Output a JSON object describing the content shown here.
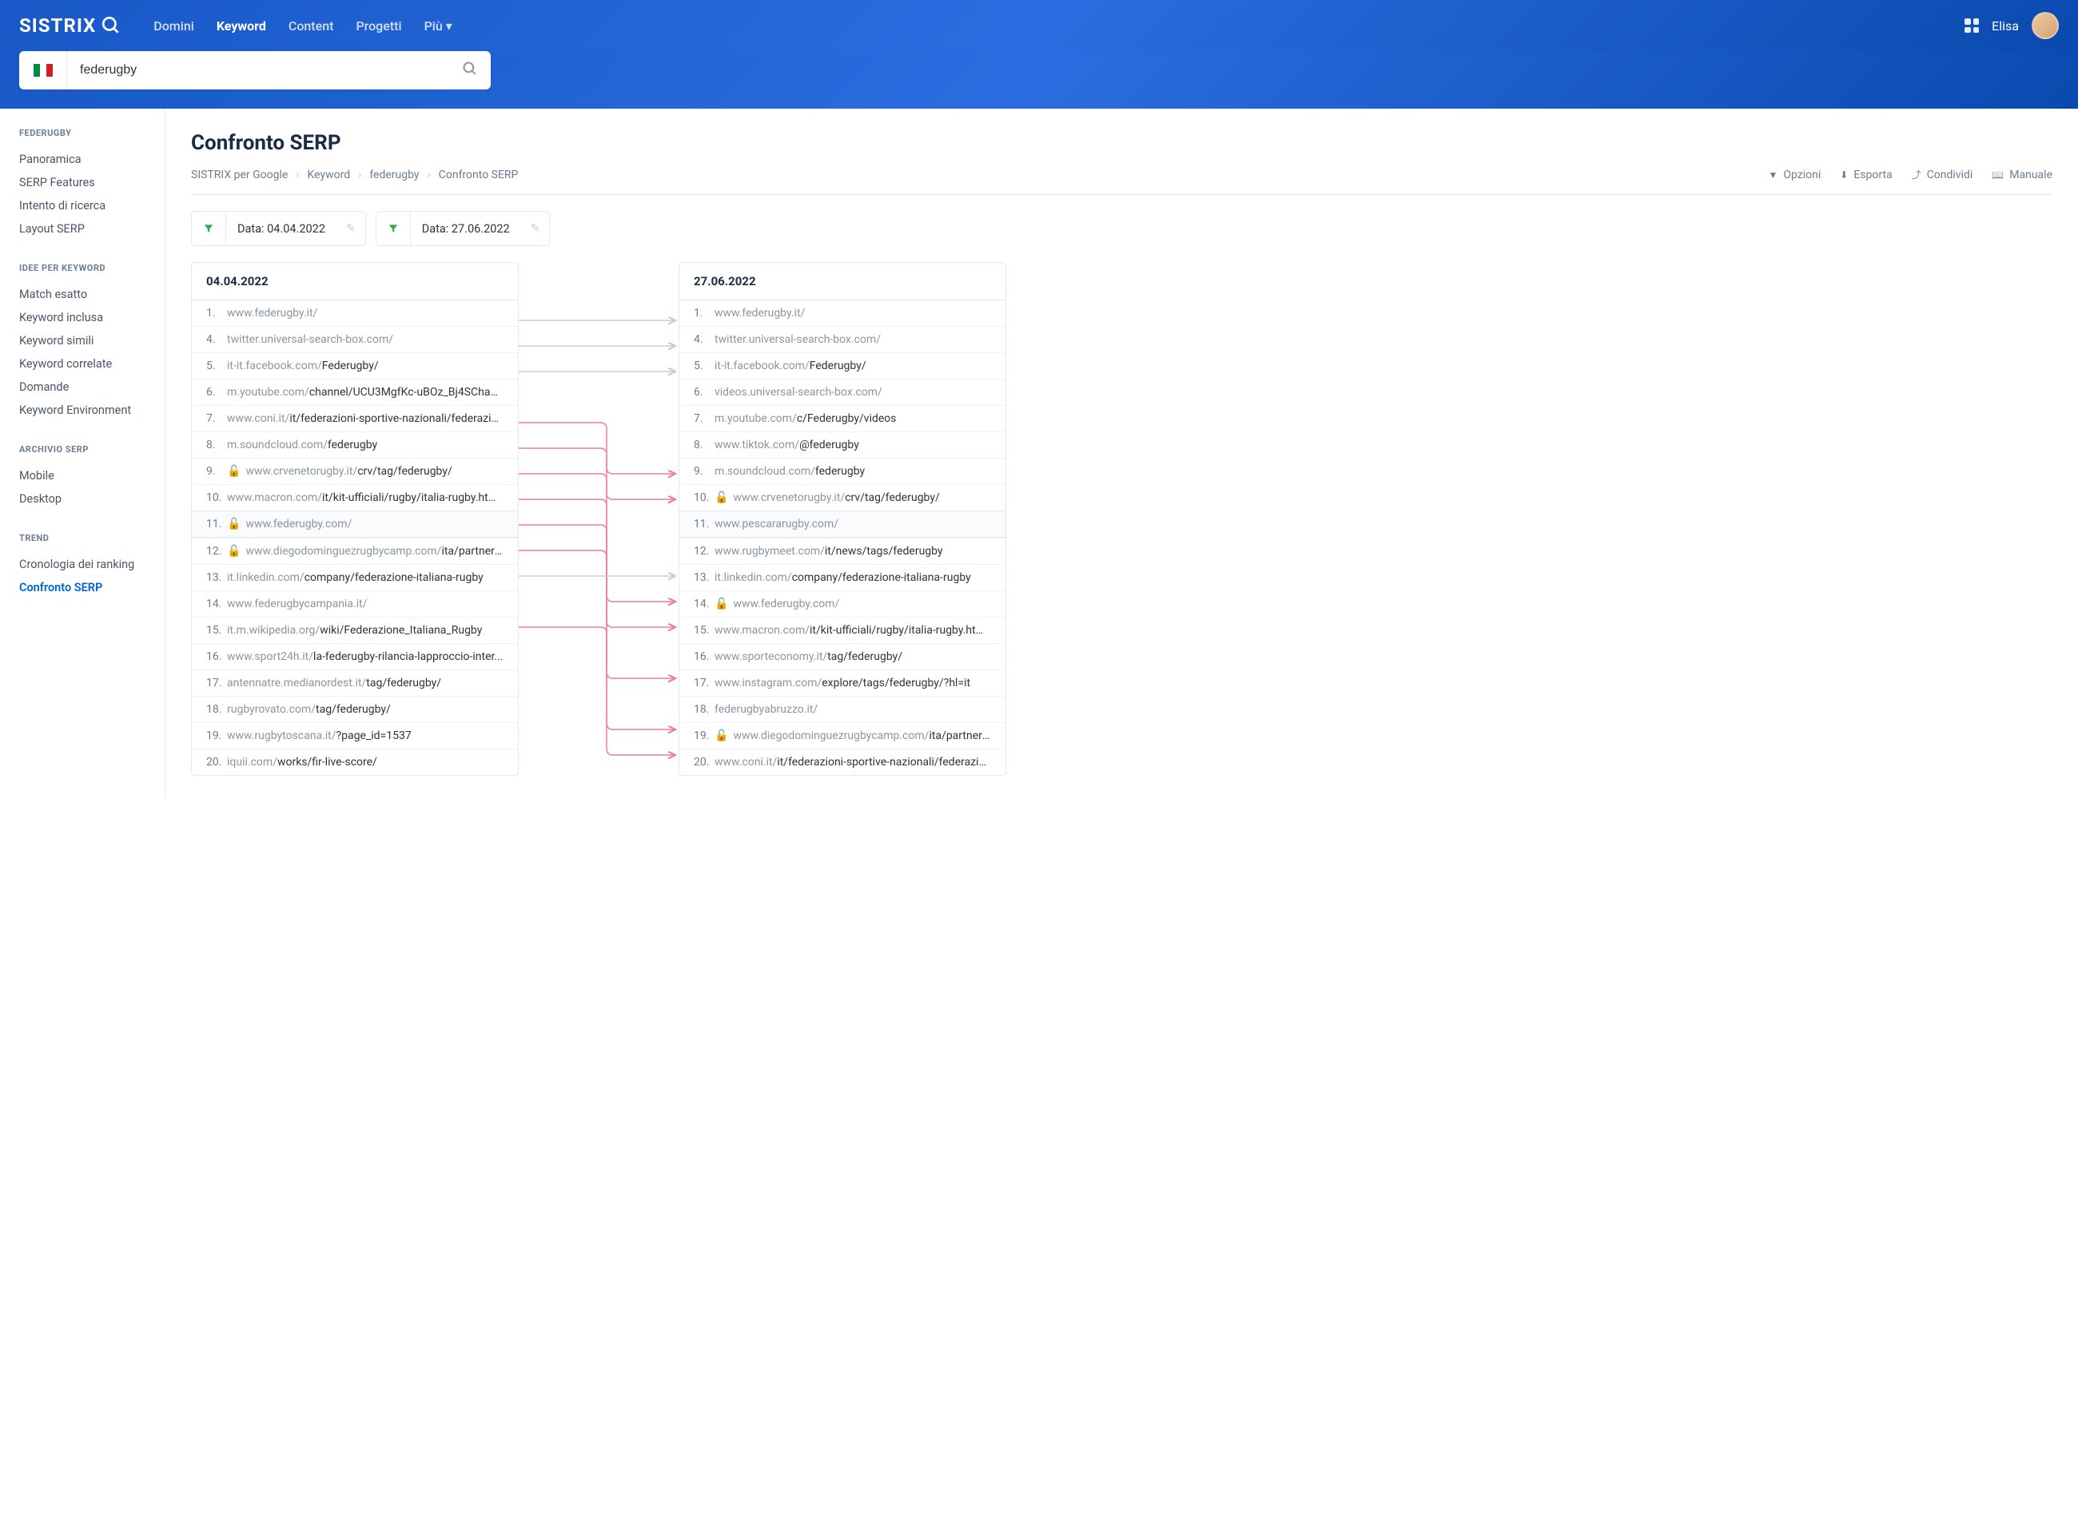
{
  "header": {
    "logo": "SISTRIX",
    "nav": [
      "Domini",
      "Keyword",
      "Content",
      "Progetti",
      "Più"
    ],
    "nav_active": 1,
    "user": "Elisa"
  },
  "search": {
    "value": "federugby"
  },
  "sidebar": {
    "sections": [
      {
        "title": "FEDERUGBY",
        "items": [
          "Panoramica",
          "SERP Features",
          "Intento di ricerca",
          "Layout SERP"
        ]
      },
      {
        "title": "IDEE PER KEYWORD",
        "items": [
          "Match esatto",
          "Keyword inclusa",
          "Keyword simili",
          "Keyword correlate",
          "Domande",
          "Keyword Environment"
        ]
      },
      {
        "title": "ARCHIVIO SERP",
        "items": [
          "Mobile",
          "Desktop"
        ]
      },
      {
        "title": "TREND",
        "items": [
          "Cronologia dei ranking",
          "Confronto SERP"
        ],
        "active": 1
      }
    ]
  },
  "page": {
    "title": "Confronto SERP",
    "breadcrumb": [
      "SISTRIX per Google",
      "Keyword",
      "federugby",
      "Confronto SERP"
    ],
    "actions": [
      "Opzioni",
      "Esporta",
      "Condividi",
      "Manuale"
    ],
    "filters": [
      "Data: 04.04.2022",
      "Data: 27.06.2022"
    ]
  },
  "serp": {
    "left": {
      "date": "04.04.2022",
      "rows": [
        {
          "rank": "1.",
          "domain": "www.federugby.it/",
          "path": ""
        },
        {
          "rank": "4.",
          "domain": "twitter.universal-search-box.com/",
          "path": ""
        },
        {
          "rank": "5.",
          "domain": "it-it.facebook.com/",
          "path": "Federugby/"
        },
        {
          "rank": "6.",
          "domain": "m.youtube.com/",
          "path": "channel/UCU3MgfKc-uBOz_Bj4SCha0..."
        },
        {
          "rank": "7.",
          "domain": "www.coni.it/",
          "path": "it/federazioni-sportive-nazionali/federazio..."
        },
        {
          "rank": "8.",
          "domain": "m.soundcloud.com/",
          "path": "federugby"
        },
        {
          "rank": "9.",
          "domain": "www.crvenetorugby.it/",
          "path": "crv/tag/federugby/",
          "lock": true
        },
        {
          "rank": "10.",
          "domain": "www.macron.com/",
          "path": "it/kit-ufficiali/rugby/italia-rugby.html..."
        },
        {
          "rank": "11.",
          "domain": "www.federugby.com/",
          "path": "",
          "lock": true,
          "band": true
        },
        {
          "rank": "12.",
          "domain": "www.diegodominguezrugbycamp.com/",
          "path": "ita/partner-s...",
          "lock": true
        },
        {
          "rank": "13.",
          "domain": "it.linkedin.com/",
          "path": "company/federazione-italiana-rugby"
        },
        {
          "rank": "14.",
          "domain": "www.federugbycampania.it/",
          "path": ""
        },
        {
          "rank": "15.",
          "domain": "it.m.wikipedia.org/",
          "path": "wiki/Federazione_Italiana_Rugby"
        },
        {
          "rank": "16.",
          "domain": "www.sport24h.it/",
          "path": "la-federugby-rilancia-lapproccio-inter..."
        },
        {
          "rank": "17.",
          "domain": "antennatre.medianordest.it/",
          "path": "tag/federugby/"
        },
        {
          "rank": "18.",
          "domain": "rugbyrovato.com/",
          "path": "tag/federugby/"
        },
        {
          "rank": "19.",
          "domain": "www.rugbytoscana.it/",
          "path": "?page_id=1537"
        },
        {
          "rank": "20.",
          "domain": "iquii.com/",
          "path": "works/fir-live-score/"
        }
      ]
    },
    "right": {
      "date": "27.06.2022",
      "rows": [
        {
          "rank": "1.",
          "domain": "www.federugby.it/",
          "path": ""
        },
        {
          "rank": "4.",
          "domain": "twitter.universal-search-box.com/",
          "path": ""
        },
        {
          "rank": "5.",
          "domain": "it-it.facebook.com/",
          "path": "Federugby/"
        },
        {
          "rank": "6.",
          "domain": "videos.universal-search-box.com/",
          "path": ""
        },
        {
          "rank": "7.",
          "domain": "m.youtube.com/",
          "path": "c/Federugby/videos"
        },
        {
          "rank": "8.",
          "domain": "www.tiktok.com/",
          "path": "@federugby"
        },
        {
          "rank": "9.",
          "domain": "m.soundcloud.com/",
          "path": "federugby"
        },
        {
          "rank": "10.",
          "domain": "www.crvenetorugby.it/",
          "path": "crv/tag/federugby/",
          "lock": true
        },
        {
          "rank": "11.",
          "domain": "www.pescararugby.com/",
          "path": "",
          "band": true
        },
        {
          "rank": "12.",
          "domain": "www.rugbymeet.com/",
          "path": "it/news/tags/federugby"
        },
        {
          "rank": "13.",
          "domain": "it.linkedin.com/",
          "path": "company/federazione-italiana-rugby"
        },
        {
          "rank": "14.",
          "domain": "www.federugby.com/",
          "path": "",
          "lock": true
        },
        {
          "rank": "15.",
          "domain": "www.macron.com/",
          "path": "it/kit-ufficiali/rugby/italia-rugby.html..."
        },
        {
          "rank": "16.",
          "domain": "www.sporteconomy.it/",
          "path": "tag/federugby/"
        },
        {
          "rank": "17.",
          "domain": "www.instagram.com/",
          "path": "explore/tags/federugby/?hl=it"
        },
        {
          "rank": "18.",
          "domain": "federugbyabruzzo.it/",
          "path": ""
        },
        {
          "rank": "19.",
          "domain": "www.diegodominguezrugbycamp.com/",
          "path": "ita/partner-s...",
          "lock": true
        },
        {
          "rank": "20.",
          "domain": "www.coni.it/",
          "path": "it/federazioni-sportive-nazionali/federazio..."
        }
      ]
    },
    "connections": [
      {
        "from": 0,
        "to": 0,
        "type": "gray"
      },
      {
        "from": 1,
        "to": 1,
        "type": "gray"
      },
      {
        "from": 2,
        "to": 2,
        "type": "gray"
      },
      {
        "from": 4,
        "to": 17,
        "type": "pink"
      },
      {
        "from": 5,
        "to": 6,
        "type": "pink"
      },
      {
        "from": 6,
        "to": 7,
        "type": "pink"
      },
      {
        "from": 7,
        "to": 12,
        "type": "pink"
      },
      {
        "from": 8,
        "to": 11,
        "type": "pink"
      },
      {
        "from": 9,
        "to": 16,
        "type": "pink"
      },
      {
        "from": 10,
        "to": 10,
        "type": "gray"
      },
      {
        "from": 12,
        "to": 14,
        "type": "pink"
      }
    ]
  }
}
